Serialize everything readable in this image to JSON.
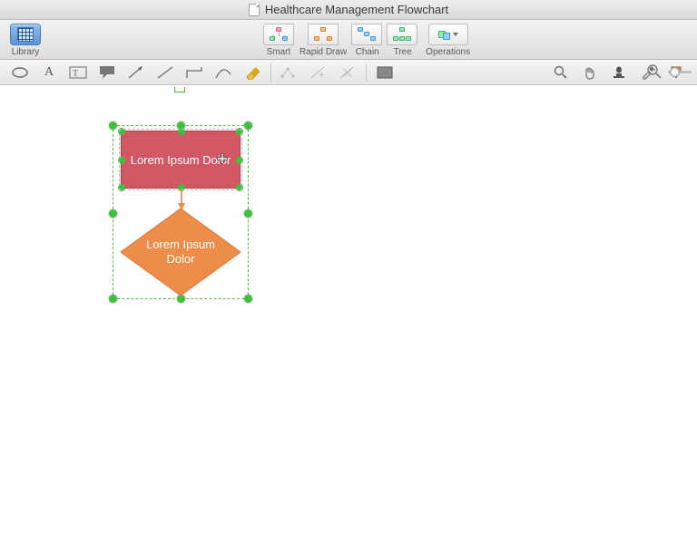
{
  "titlebar": {
    "title": "Healthcare Management Flowchart"
  },
  "toolbar": {
    "library": "Library",
    "modes": {
      "smart": "Smart",
      "rapid": "Rapid Draw",
      "chain": "Chain",
      "tree": "Tree"
    },
    "operations": "Operations"
  },
  "shapes": {
    "process": {
      "text": "Lorem Ipsum Dolor"
    },
    "decision": {
      "text": "Lorem Ipsum Dolor"
    }
  },
  "colors": {
    "process_fill": "#d25864",
    "process_stroke": "#b53f4c",
    "decision_fill": "#ee8c4a",
    "decision_stroke": "#d9742f",
    "selection": "#3ec13e"
  }
}
